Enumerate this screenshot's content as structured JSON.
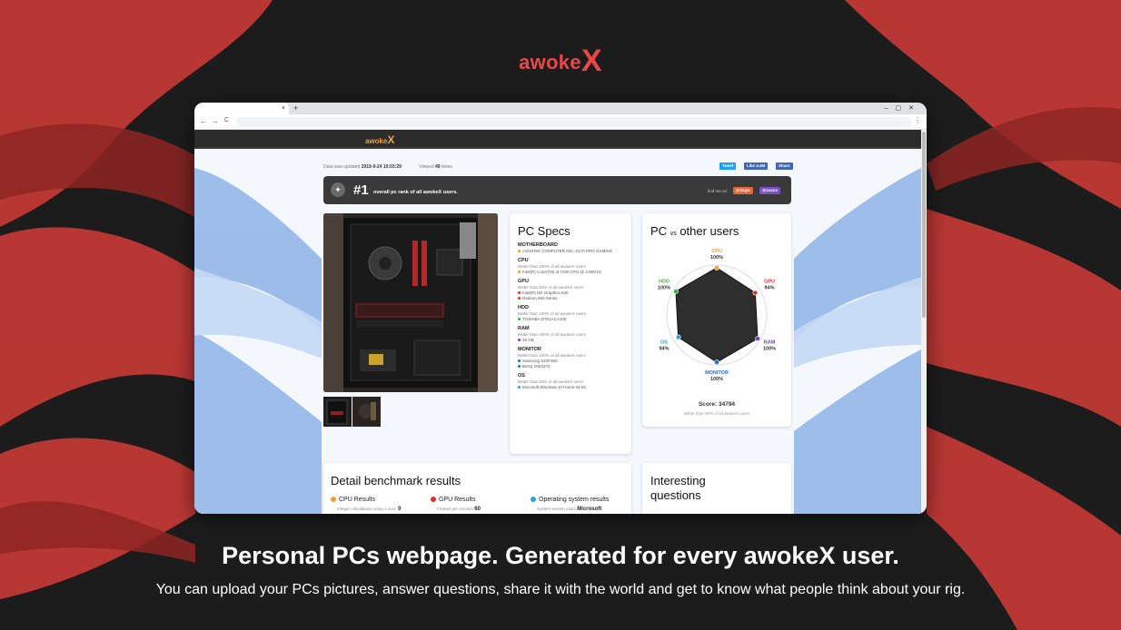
{
  "brand": {
    "name": "awoke",
    "mark": "X"
  },
  "browser": {
    "close_tab": "×",
    "new_tab": "+",
    "back": "←",
    "forward": "→",
    "reload": "C",
    "menu": "⋮",
    "window_controls": "–▢✕"
  },
  "site": {
    "brand_name": "awoke",
    "brand_mark": "X",
    "meta": {
      "updated_label": "Data was updated",
      "updated_value": "2019-9-24 10:03:29",
      "viewed_label": "Viewed",
      "viewed_value": "49",
      "viewed_suffix": "times"
    },
    "share": {
      "tweet": "Tweet",
      "like": "Like 4.4M",
      "share": "Share"
    },
    "rank": {
      "number": "#1",
      "text": "overall pc rank of all awokeX users.",
      "find_me": "find me on:",
      "badge1": "@Guys",
      "badge2": "@xxxxx"
    },
    "specs": {
      "title": "PC Specs",
      "items": [
        {
          "label": "MOTHERBOARD",
          "sub": "",
          "entries": [
            {
              "text": "ASUSTeK COMPUTER INC. Z170 PRO GAMING",
              "color": "#f0a030"
            }
          ]
        },
        {
          "label": "CPU",
          "sub": "Better than 100% of all awokeX users",
          "entries": [
            {
              "text": "Intel(R) Core(TM) i3-7100 CPU @ 3.90GHz",
              "color": "#f0a030"
            }
          ]
        },
        {
          "label": "GPU",
          "sub": "Better than 94% of all awokeX users",
          "entries": [
            {
              "text": "Intel(R) HD Graphics 630",
              "color": "#e03030"
            },
            {
              "text": "Radeon 550 Series",
              "color": "#e03030"
            }
          ]
        },
        {
          "label": "HDD",
          "sub": "Better than 100% of all awokeX users",
          "entries": [
            {
              "text": "TOSHIBA DT01ACA100",
              "color": "#40b040"
            }
          ]
        },
        {
          "label": "RAM",
          "sub": "Better than 100% of all awokeX users",
          "entries": [
            {
              "text": "16 GB",
              "color": "#7040c0"
            }
          ]
        },
        {
          "label": "MONITOR",
          "sub": "Better than 100% of all awokeX users",
          "entries": [
            {
              "text": "Samsung S22F350",
              "color": "#2070d0"
            },
            {
              "text": "BenQ GW2270",
              "color": "#2070d0"
            }
          ]
        },
        {
          "label": "OS",
          "sub": "Better than 94% of all awokeX users",
          "entries": [
            {
              "text": "Microsoft Windows 10 Home 64-bit",
              "color": "#30a0e0"
            }
          ]
        }
      ]
    },
    "radar": {
      "title_pre": "PC",
      "title_vs": "vs",
      "title_post": "other users",
      "axes": [
        {
          "name": "CPU",
          "value": 100,
          "label": "100%",
          "color": "#f0a030"
        },
        {
          "name": "GPU",
          "value": 94,
          "label": "94%",
          "color": "#e03030"
        },
        {
          "name": "RAM",
          "value": 100,
          "label": "100%",
          "color": "#7040c0"
        },
        {
          "name": "MONITOR",
          "value": 100,
          "label": "100%",
          "color": "#2070d0"
        },
        {
          "name": "OS",
          "value": 94,
          "label": "94%",
          "color": "#30a0e0"
        },
        {
          "name": "HDD",
          "value": 100,
          "label": "100%",
          "color": "#40b040"
        }
      ],
      "score": "Score: 34794",
      "score_sub": "Better than 99% of all awokeX users"
    },
    "detail": {
      "title": "Detail benchmark results",
      "results": [
        {
          "name": "CPU Results",
          "color": "#f0a030",
          "sub": "Integer calculations using 1 core:",
          "value": "0"
        },
        {
          "name": "GPU Results",
          "color": "#e03030",
          "sub": "Frames per second:",
          "value": "60"
        },
        {
          "name": "Operating system results",
          "color": "#30a0e0",
          "sub": "System version used:",
          "value": "Microsoft"
        }
      ]
    },
    "interesting": {
      "line1": "Interesting",
      "line2": "questions"
    }
  },
  "headline": "Personal PCs webpage. Generated for every awokeX user.",
  "subline": "You can upload your PCs pictures, answer questions, share it with the world and get to know what people think about your rig."
}
